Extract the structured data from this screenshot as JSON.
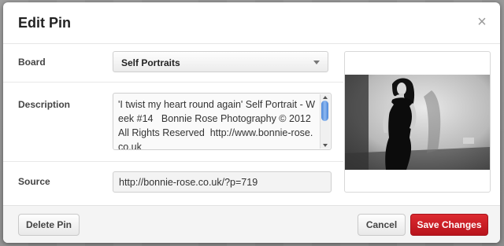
{
  "dialog": {
    "title": "Edit Pin",
    "close_symbol": "×"
  },
  "fields": {
    "board": {
      "label": "Board",
      "value": "Self Portraits"
    },
    "description": {
      "label": "Description",
      "value": "'I twist my heart round again' Self Portrait - Week #14   Bonnie Rose Photography © 2012 All Rights Reserved  http://www.bonnie-rose.co.uk"
    },
    "source": {
      "label": "Source",
      "value": "http://bonnie-rose.co.uk/?p=719"
    }
  },
  "footer": {
    "delete_label": "Delete Pin",
    "cancel_label": "Cancel",
    "save_label": "Save Changes"
  },
  "colors": {
    "primary_button": "#c8161d"
  },
  "icons": [
    "close-icon",
    "dropdown-arrow-icon",
    "scrollbar"
  ]
}
